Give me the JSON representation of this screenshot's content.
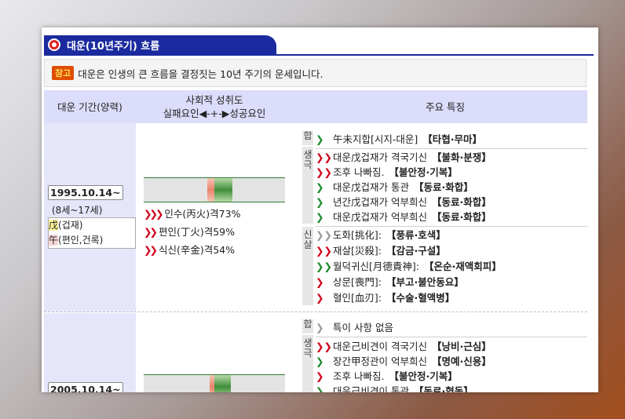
{
  "title": "대운(10년주기) 흐름",
  "notice": {
    "badge": "참고",
    "text": "대운은 인생의 큰 흐름을 결정짓는 10년 주기의 운세입니다."
  },
  "header": {
    "period": "대운 기간(양력)",
    "social_line1": "사회적 성취도",
    "social_line2": "실패요인◀-+-▶성공요인",
    "features": "주요 특징"
  },
  "labels": {
    "hap": "합",
    "saeng": "생극",
    "sinsal": "신살"
  },
  "periods": [
    {
      "date": "1995.10.14~",
      "age": "(8세~17세)",
      "gan_char": "戊",
      "gan_desc": "(겁재)",
      "ji_char": "午",
      "ji_desc": "(편인,건록)",
      "bar": {
        "neg": 0.27,
        "pos": 0.73
      },
      "yuk": [
        {
          "arrows": "❯❯❯",
          "text": "인수(丙火)격73%"
        },
        {
          "arrows": "❯❯",
          "text": "편인(丁火)격59%"
        },
        {
          "arrows": "❯❯",
          "text": "식신(辛金)격54%"
        }
      ],
      "hap": [
        {
          "mark": "❯",
          "color": "g",
          "text": "午未지합[시지-대운]",
          "tag": "【타협·무마】"
        }
      ],
      "saeng": [
        {
          "mark": "❯❯",
          "color": "r",
          "text": "대운戊겁재가 격국기신",
          "tag": "【불화·분쟁】"
        },
        {
          "mark": "❯❯",
          "color": "r",
          "text": "조후 나빠짐.",
          "tag": "【불안정·기복】"
        },
        {
          "mark": "❯",
          "color": "g",
          "text": "대운戊겁재가 통관",
          "tag": "【동료·화합】"
        },
        {
          "mark": "❯",
          "color": "g",
          "text": "년간戊겁재가 억부희신",
          "tag": "【동료·화합】"
        },
        {
          "mark": "❯",
          "color": "g",
          "text": "대운戊겁재가 억부희신",
          "tag": "【동료·화합】"
        }
      ],
      "sinsal": [
        {
          "mark": "❯❯",
          "color": "gr",
          "text": "도화[挑化]:",
          "tag": "【풍류·호색】"
        },
        {
          "mark": "❯❯",
          "color": "r",
          "text": "재살[災殺]:",
          "tag": "【감금·구설】"
        },
        {
          "mark": "❯❯",
          "color": "g",
          "text": "월덕귀신[月德貴神]:",
          "tag": "【온순·재액회피】"
        },
        {
          "mark": "❯",
          "color": "r",
          "text": "상문[喪門]:",
          "tag": "【부고·불안동요】"
        },
        {
          "mark": "❯",
          "color": "r",
          "text": "혈인[血刃]:",
          "tag": "【수술·혈액병】"
        }
      ]
    },
    {
      "date": "2005.10.14~",
      "bar": {
        "neg": 0.2,
        "pos": 0.65
      },
      "hap": [
        {
          "mark": "❯",
          "color": "gr",
          "text": "특이 사항 없음",
          "tag": ""
        }
      ],
      "saeng": [
        {
          "mark": "❯❯",
          "color": "r",
          "text": "대운己비견이 격국기신",
          "tag": "【낭비·근심】"
        },
        {
          "mark": "❯",
          "color": "g",
          "text": "장간甲정관이 억부희신",
          "tag": "【명예·신용】"
        },
        {
          "mark": "❯",
          "color": "r",
          "text": "조후 나빠짐.",
          "tag": "【불안정·기복】"
        },
        {
          "mark": "❯",
          "color": "g",
          "text": "대운己비견이 통관",
          "tag": "【동료·협동】"
        }
      ]
    }
  ]
}
